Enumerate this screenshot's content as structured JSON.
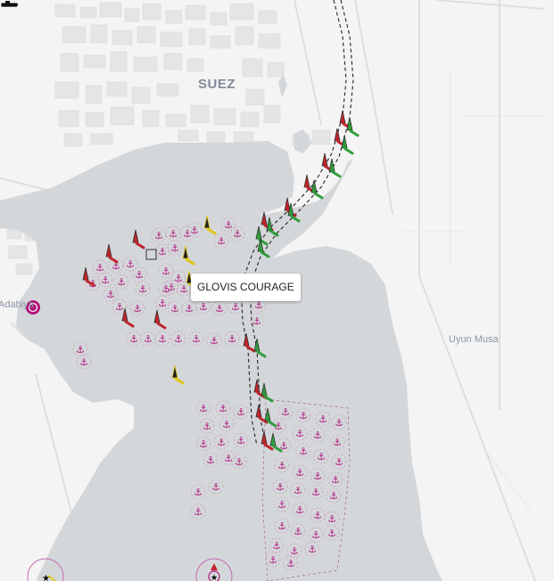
{
  "map": {
    "places": {
      "suez": "SUEZ",
      "uyun_musa": "Uyun Musa",
      "adabiya": "Adabiya"
    },
    "vessel": {
      "name": "GLOVIS COURAGE",
      "icon": "ship-icon"
    },
    "colors": {
      "water": "#d4d7da",
      "land": "#f4f4f4",
      "anchorage": "#b0127a",
      "port_buoy": "#c0242b",
      "starboard_buoy": "#2e9e3b",
      "cardinal_buoy": "#e0c61a",
      "channel_line": "#222222"
    },
    "icons": [
      "anchor-icon",
      "port-buoy-icon",
      "starboard-buoy-icon",
      "cardinal-buoy-icon",
      "lighthouse-icon",
      "ship-icon"
    ]
  }
}
